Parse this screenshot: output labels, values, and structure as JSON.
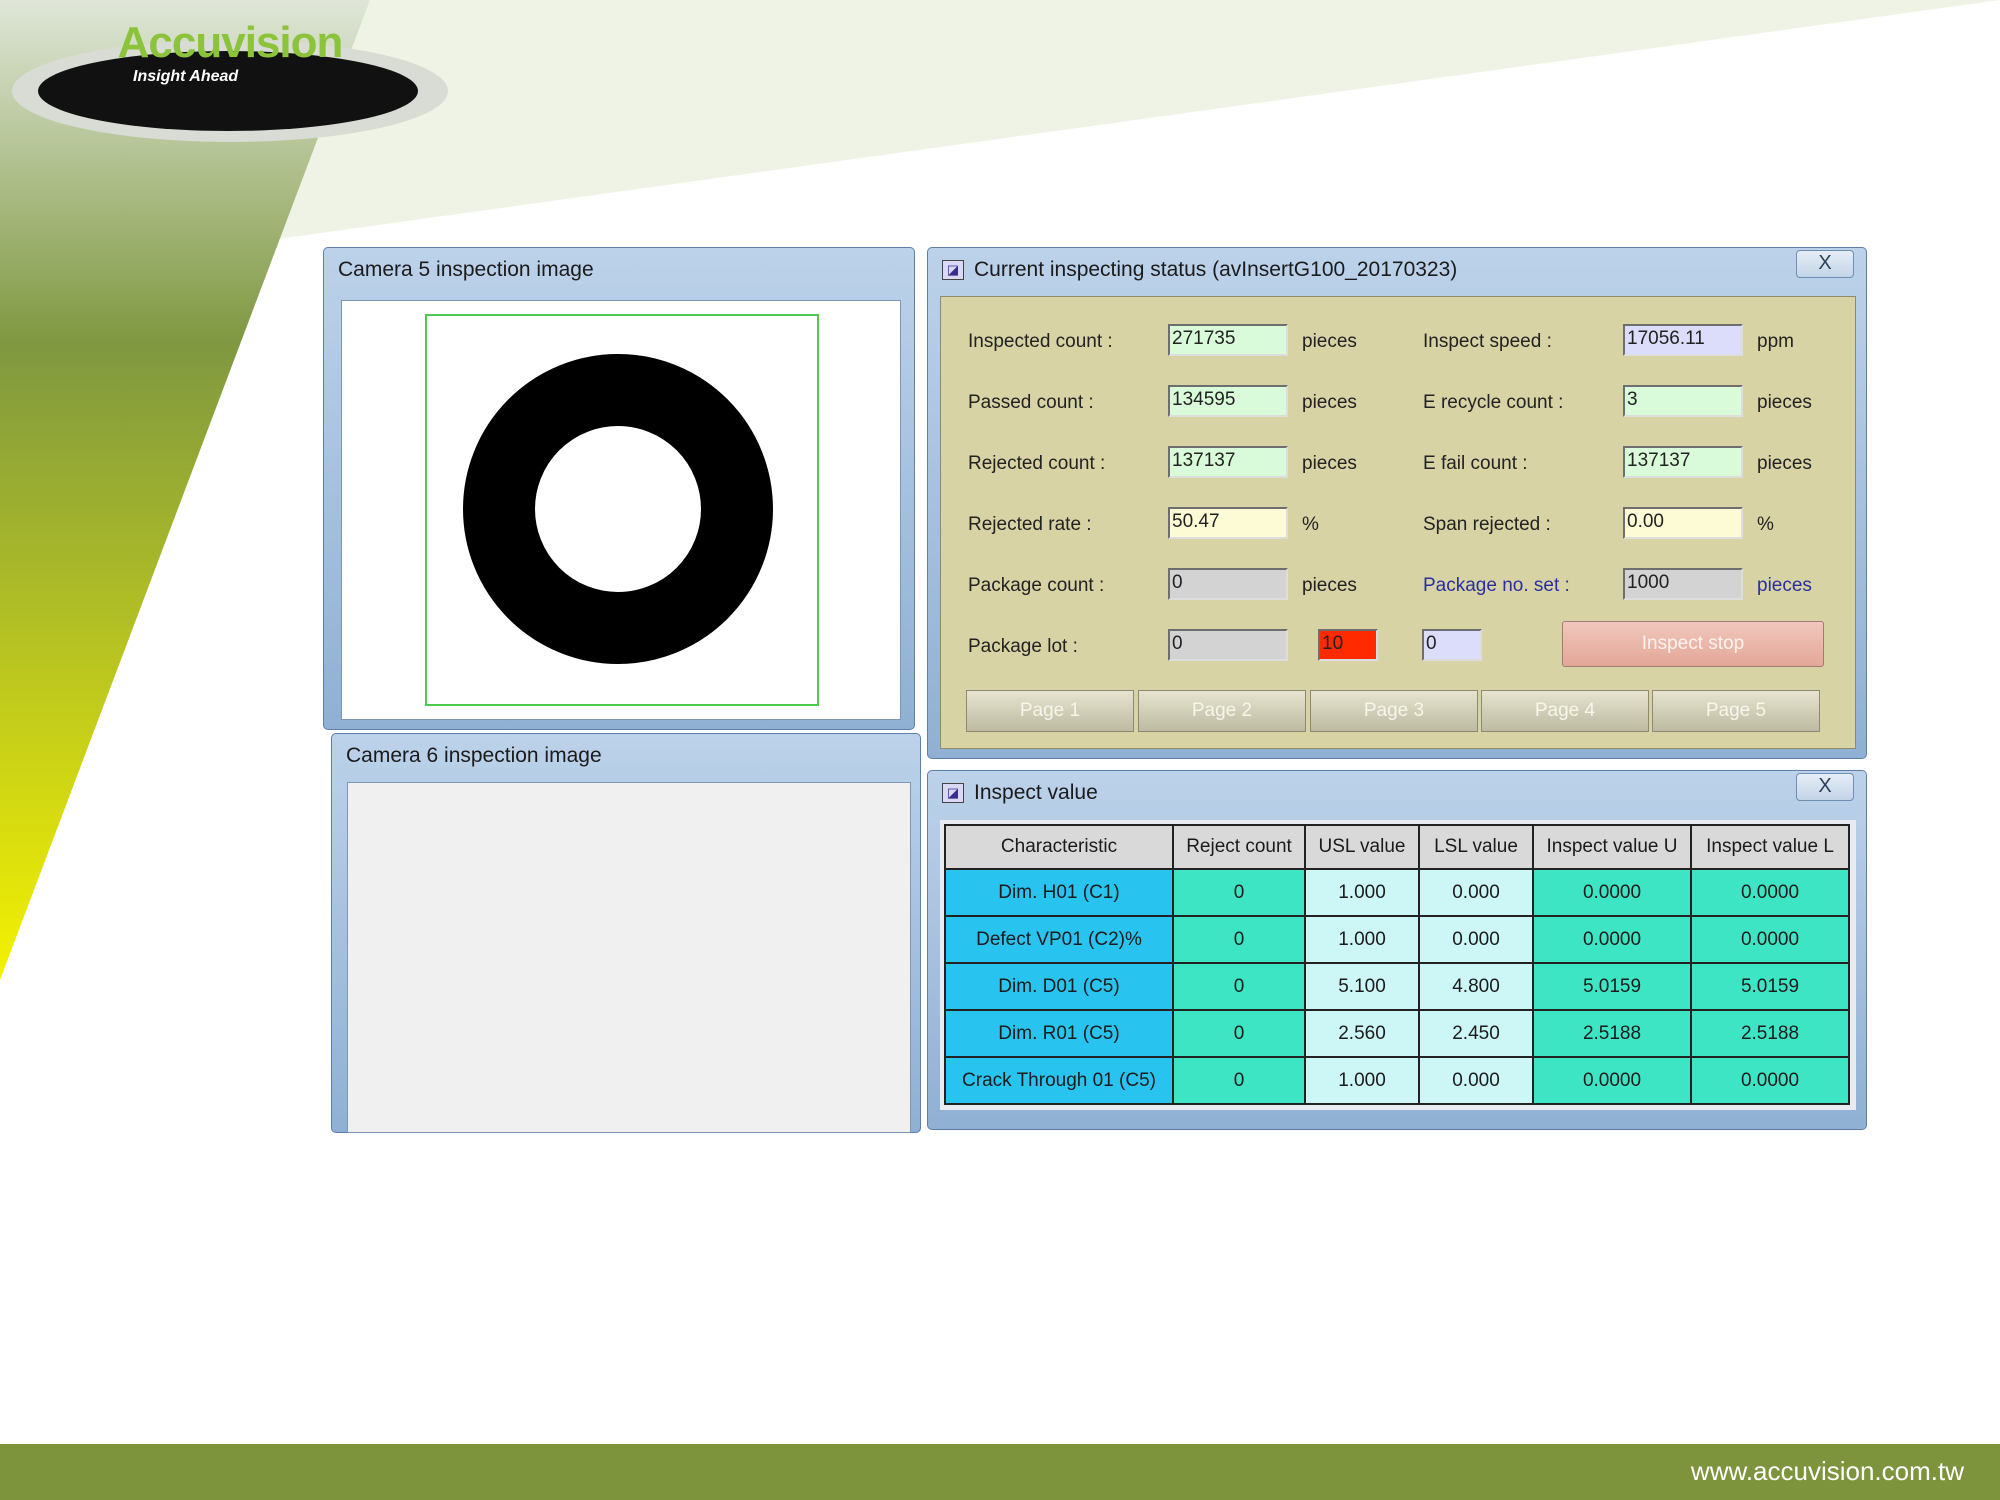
{
  "brand": {
    "logo_text": "Accuvision",
    "tagline": "Insight Ahead",
    "url": "www.accuvision.com.tw"
  },
  "colors": {
    "green_accent": "#7d933c",
    "table_char": "#29c3f0",
    "table_cyan": "#3ee5c4",
    "table_pale": "#cdf7f7",
    "alert_red": "#ff2a00"
  },
  "camera5": {
    "title": "Camera 5 inspection image"
  },
  "camera6": {
    "title": "Camera 6 inspection image"
  },
  "status": {
    "title": "Current inspecting status (avInsertG100_20170323)",
    "close": "X",
    "inspected_label": "Inspected count :",
    "inspected_value": "271735",
    "inspected_unit": "pieces",
    "speed_label": "Inspect speed :",
    "speed_value": "17056.11",
    "speed_unit": "ppm",
    "passed_label": "Passed count :",
    "passed_value": "134595",
    "passed_unit": "pieces",
    "recycle_label": "E recycle count :",
    "recycle_value": "3",
    "recycle_unit": "pieces",
    "rejected_label": "Rejected count :",
    "rejected_value": "137137",
    "rejected_unit": "pieces",
    "efail_label": "E fail count :",
    "efail_value": "137137",
    "efail_unit": "pieces",
    "rate_label": "Rejected rate :",
    "rate_value": "50.47",
    "rate_unit": "%",
    "span_label": "Span rejected :",
    "span_value": "0.00",
    "span_unit": "%",
    "pkgcount_label": "Package count :",
    "pkgcount_value": "0",
    "pkgcount_unit": "pieces",
    "pkgset_label": "Package no. set :",
    "pkgset_value": "1000",
    "pkgset_unit": "pieces",
    "lot_label": "Package lot :",
    "lot_value": "0",
    "lot_red_value": "10",
    "lot_blue_value": "0",
    "stop_button": "Inspect stop",
    "pages": [
      "Page 1",
      "Page 2",
      "Page 3",
      "Page 4",
      "Page 5"
    ]
  },
  "inspect": {
    "title": "Inspect value",
    "close": "X",
    "headers": [
      "Characteristic",
      "Reject count",
      "USL value",
      "LSL value",
      "Inspect value U",
      "Inspect value L"
    ],
    "rows": [
      [
        "Dim. H01 (C1)",
        "0",
        "1.000",
        "0.000",
        "0.0000",
        "0.0000"
      ],
      [
        "Defect VP01 (C2)%",
        "0",
        "1.000",
        "0.000",
        "0.0000",
        "0.0000"
      ],
      [
        "Dim. D01 (C5)",
        "0",
        "5.100",
        "4.800",
        "5.0159",
        "5.0159"
      ],
      [
        "Dim. R01 (C5)",
        "0",
        "2.560",
        "2.450",
        "2.5188",
        "2.5188"
      ],
      [
        "Crack Through 01 (C5)",
        "0",
        "1.000",
        "0.000",
        "0.0000",
        "0.0000"
      ]
    ]
  }
}
